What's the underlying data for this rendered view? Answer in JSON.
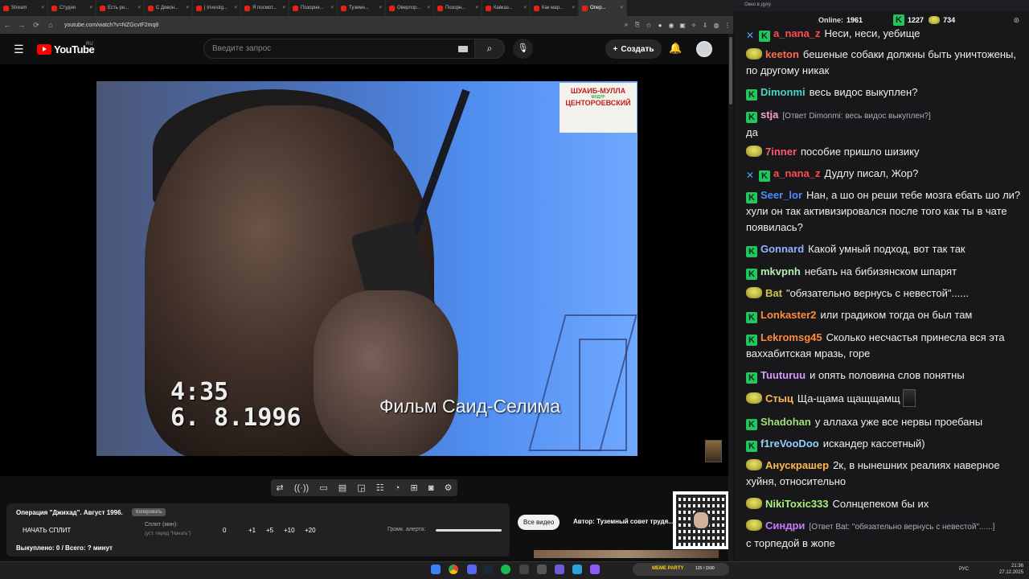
{
  "browser": {
    "tabs": [
      "Stream",
      "Студия",
      "Есть ре...",
      "С Девон...",
      "| Investig...",
      "Я посмот...",
      "Позорни...",
      "Туземн...",
      "Оверлор...",
      "Позорн...",
      "Кавказ...",
      "Как мар...",
      "Опер..."
    ],
    "url": "youtube.com/watch?v=NZGcvtF2mq8"
  },
  "youtube": {
    "logo_text": "YouTube",
    "region": "RU",
    "search_placeholder": "Введите запрос",
    "create_label": "Создать"
  },
  "video": {
    "logo_line1": "ШУАИБ-МУЛЛА",
    "logo_line2": "ЦЕНТОРОЕВСКИЙ",
    "logo_sub": "МУДУР",
    "time": "4:35",
    "date": "6. 8.1996",
    "caption": "Фильм  Саид-Селима"
  },
  "controls": {
    "icons": [
      "repeat-icon",
      "broadcast-icon",
      "cast-icon",
      "clapper-icon",
      "pip-icon",
      "subtitles-icon",
      "speed-icon",
      "add-icon",
      "camera-icon",
      "settings-icon"
    ]
  },
  "panel": {
    "title": "Операция \"Джихад\". Август 1996.",
    "copy_label": "Копировать",
    "start_label": "НАЧАТЬ СПЛИТ",
    "split_label": "Сплит (мин):",
    "split_sub": "(уст. перед \"Начать\")",
    "split_value": "0",
    "increments": [
      "+1",
      "+5",
      "+10",
      "+20"
    ],
    "alert_label": "Громк. алерта:",
    "alert_level": 1.0,
    "bought": "Выкуплено: 0 / Всего: ? минут"
  },
  "tags": {
    "all_video": "Все видео",
    "author": "Автор: Туземный совет трудя..."
  },
  "chat": {
    "window_title": "Окно в духу",
    "online_label": "Online:",
    "online_count": "1961",
    "points_a": "1227",
    "points_b": "734",
    "colors": {
      "green": "#22c55e",
      "blue": "#4aa3ff"
    },
    "messages": [
      {
        "badges": [
          "sword",
          "k"
        ],
        "user": "a_nana_z",
        "color": "#ff4d4d",
        "text": "Неси, неси, уебище"
      },
      {
        "badges": [
          "y"
        ],
        "user": "keeton",
        "color": "#ff6a4d",
        "text": "бешеные собаки должны быть уничтожены, по другому никак"
      },
      {
        "badges": [
          "k"
        ],
        "user": "Dimonmi",
        "color": "#49d3c5",
        "text": "весь видос выкуплен?"
      },
      {
        "badges": [
          "k"
        ],
        "user": "stja",
        "color": "#f0a5c8",
        "reply": "[Ответ Dimonmi: весь видос выкуплен?]",
        "text": "да"
      },
      {
        "badges": [
          "y"
        ],
        "user": "7inner",
        "color": "#ff5a6e",
        "text": "пособие пришло шизику"
      },
      {
        "badges": [
          "sword",
          "k"
        ],
        "user": "a_nana_z",
        "color": "#ff4d4d",
        "text": "Дудлу писал, Жор?"
      },
      {
        "badges": [
          "k"
        ],
        "user": "Seer_lor",
        "color": "#4a8dff",
        "text": "Нан, а шо он реши тебе мозга ебать шо ли? хули он так активизировался после того как ты в чате появилась?"
      },
      {
        "badges": [
          "k"
        ],
        "user": "Gonnard",
        "color": "#8fb3ff",
        "text": "Какой умный подход, вот так так"
      },
      {
        "badges": [
          "k"
        ],
        "user": "mkvpnh",
        "color": "#b3f0b3",
        "text": "небать на бибизянском шпарят"
      },
      {
        "badges": [
          "y"
        ],
        "user": "Bat",
        "color": "#d4c24a",
        "text": "\"обязательно вернусь с невестой\"......"
      },
      {
        "badges": [
          "k"
        ],
        "user": "Lonkaster2",
        "color": "#ff8c3a",
        "text": "или градиком тогда он был там"
      },
      {
        "badges": [
          "k"
        ],
        "user": "Lekromsg45",
        "color": "#ff8c3a",
        "text": "Сколько несчастья принесла вся эта ваххабитская мразь, горе"
      },
      {
        "badges": [
          "k"
        ],
        "user": "Tuuturuu",
        "color": "#d49bff",
        "text": "и опять половина слов понятны"
      },
      {
        "badges": [
          "y"
        ],
        "user": "Стыц",
        "color": "#ffb84d",
        "text": "Ща-щама щащщамщ"
      },
      {
        "badges": [
          "k"
        ],
        "user": "Shadohan",
        "color": "#9be27a",
        "text": "у аллаха уже все нервы проебаны"
      },
      {
        "badges": [
          "k"
        ],
        "user": "f1reVooDoo",
        "color": "#8fd0ff",
        "text": "искандер кассетный)"
      },
      {
        "badges": [
          "y"
        ],
        "user": "Анускрашер",
        "color": "#ffb84d",
        "text": "2к, в нынешних реалиях наверное хуйня, относительно"
      },
      {
        "badges": [
          "y"
        ],
        "user": "NikiToxic333",
        "color": "#a8f07a",
        "text": "Солнцепеком бы их"
      },
      {
        "badges": [
          "y"
        ],
        "user": "Синдри",
        "color": "#c67bff",
        "reply": "[Ответ Bat: \"обязательно вернусь с невестой\"......]",
        "text": "с торпедой в жопе"
      }
    ]
  },
  "taskbar": {
    "memes_label": "МЕМЕ PARTY",
    "memes_count": "125 / 1590",
    "lang": "РУС",
    "time": "21:36",
    "date": "27.12.2025"
  }
}
